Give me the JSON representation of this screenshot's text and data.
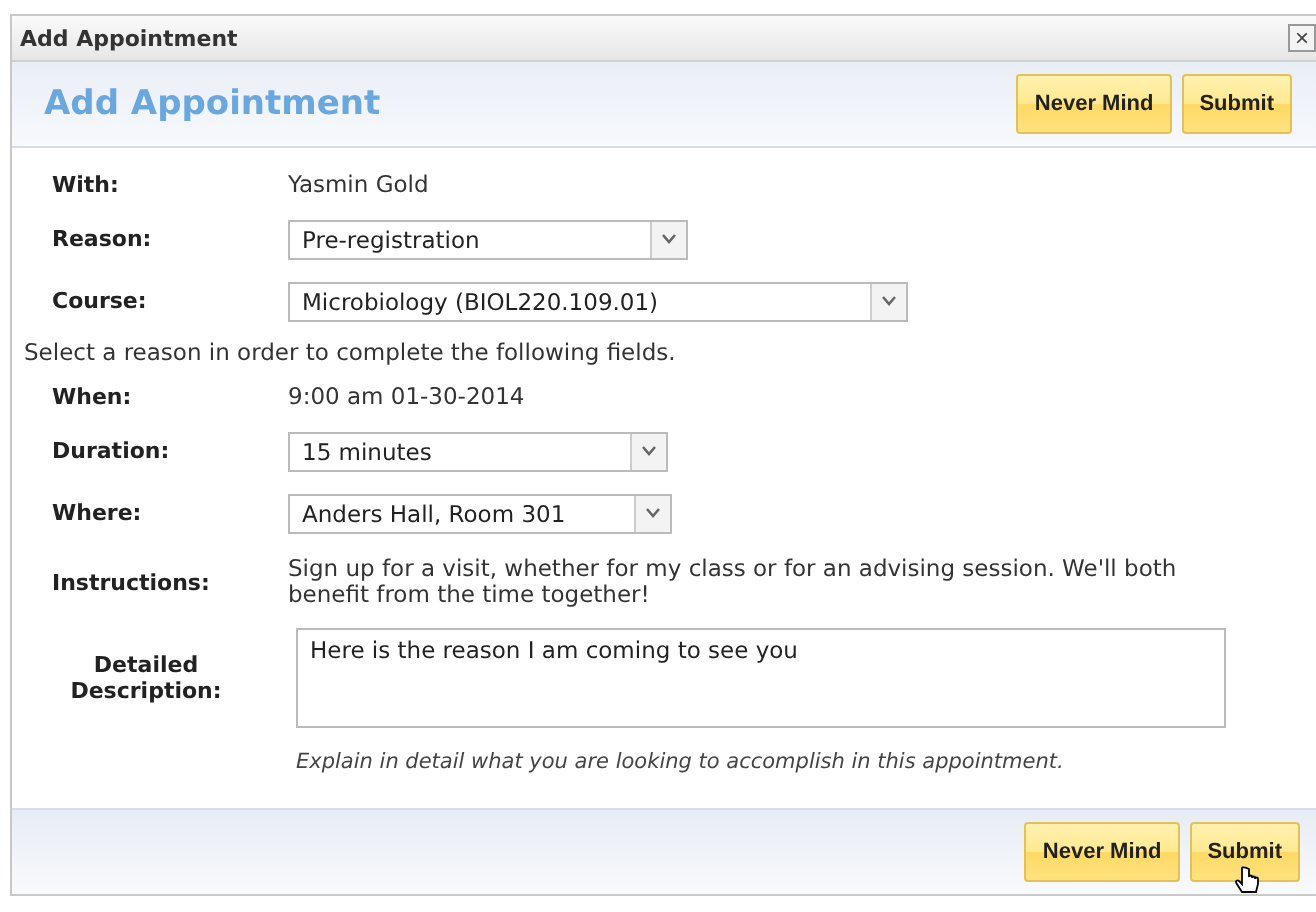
{
  "window": {
    "title": "Add Appointment",
    "close": "×"
  },
  "header": {
    "title": "Add Appointment",
    "buttons": [
      "Never Mind",
      "Submit"
    ]
  },
  "rows": [
    {
      "kind": "text",
      "label": "With:",
      "value": "Yasmin Gold"
    },
    {
      "kind": "select",
      "label": "Reason:",
      "value": "Pre-registration"
    },
    {
      "kind": "select",
      "label": "Course:",
      "value": "Microbiology (BIOL220.109.01)"
    },
    {
      "kind": "note",
      "value": "Select a reason in order to complete the following fields."
    },
    {
      "kind": "text",
      "label": "When:",
      "value": "9:00 am 01-30-2014"
    },
    {
      "kind": "select",
      "label": "Duration:",
      "value": "15 minutes"
    },
    {
      "kind": "select",
      "label": "Where:",
      "value": "Anders Hall, Room 301"
    },
    {
      "kind": "text",
      "label": "Instructions:",
      "value": "Sign up for a visit, whether for my class or for an advising session. We'll both benefit from the time together!"
    },
    {
      "kind": "textarea",
      "label": "Detailed Description:",
      "value": "Here is the reason I am coming to see you"
    },
    {
      "kind": "hint",
      "value": "Explain in detail what you are looking to accomplish in this appointment."
    }
  ],
  "footer": {
    "buttons": [
      "Never Mind",
      "Submit"
    ]
  }
}
